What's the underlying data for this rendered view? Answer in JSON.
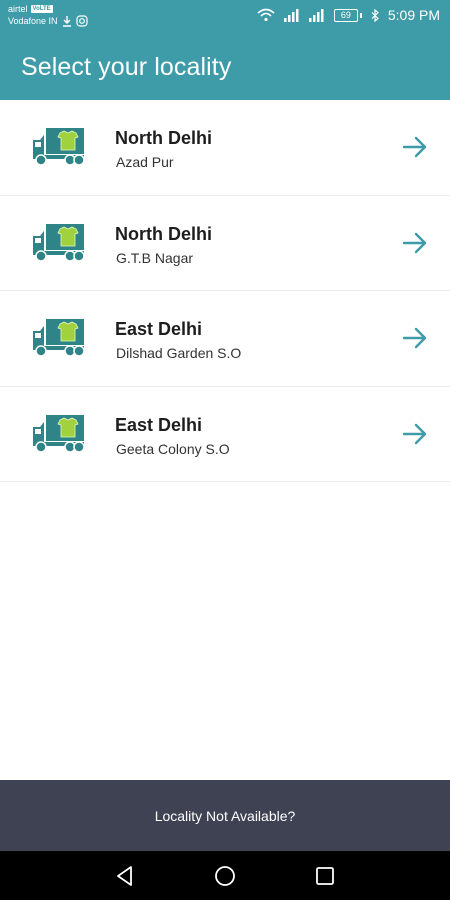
{
  "status_bar": {
    "carrier1": "airtel",
    "volte": "VoLTE",
    "carrier2": "Vodafone IN",
    "battery": "69",
    "time": "5:09 PM"
  },
  "header": {
    "title": "Select your locality"
  },
  "localities": [
    {
      "city": "North Delhi",
      "area": "Azad Pur"
    },
    {
      "city": "North Delhi",
      "area": "G.T.B Nagar"
    },
    {
      "city": "East Delhi",
      "area": "Dilshad Garden S.O"
    },
    {
      "city": "East Delhi",
      "area": "Geeta Colony S.O"
    }
  ],
  "footer": {
    "label": "Locality Not Available?"
  },
  "colors": {
    "primary": "#3e9ba8",
    "footer": "#3f4253",
    "truck": "#2f8487",
    "shirt": "#9fd23c"
  },
  "icons": {
    "truck": "delivery-truck-icon",
    "arrow": "arrow-right-icon"
  }
}
